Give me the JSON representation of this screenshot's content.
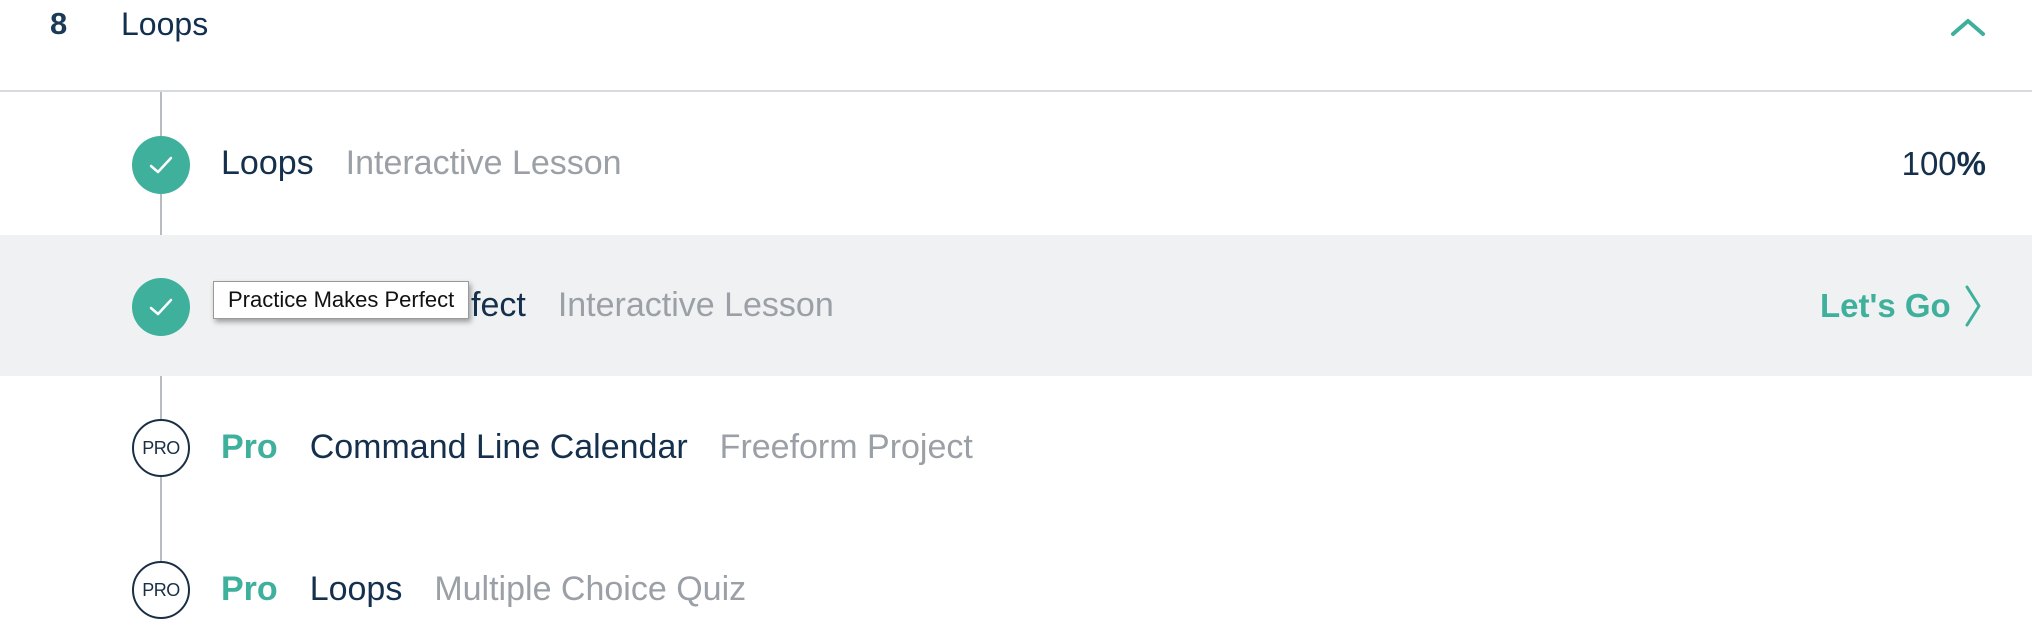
{
  "section": {
    "number": "8",
    "title": "Loops",
    "collapse_icon": "chevron-up-icon"
  },
  "lessons": [
    {
      "status": "completed",
      "title": "Loops",
      "type": "Interactive Lesson",
      "progress_number": "100",
      "progress_sign": "%"
    },
    {
      "status": "completed",
      "title": "Practice Makes Perfect",
      "visible_title_fragment": "fect",
      "type": "Interactive Lesson",
      "action_label": "Let's Go",
      "action_icon": "chevron-right-icon"
    },
    {
      "status": "pro",
      "badge": "PRO",
      "pro_label": "Pro",
      "title": "Command Line Calendar",
      "type": "Freeform Project"
    },
    {
      "status": "pro",
      "badge": "PRO",
      "pro_label": "Pro",
      "title": "Loops",
      "type": "Multiple Choice Quiz"
    }
  ],
  "tooltip": {
    "text": "Practice Makes Perfect"
  },
  "colors": {
    "accent": "#3fb09b",
    "text_dark": "#14304c",
    "text_muted": "#9aa0a6",
    "row_highlight": "#f0f1f2"
  }
}
